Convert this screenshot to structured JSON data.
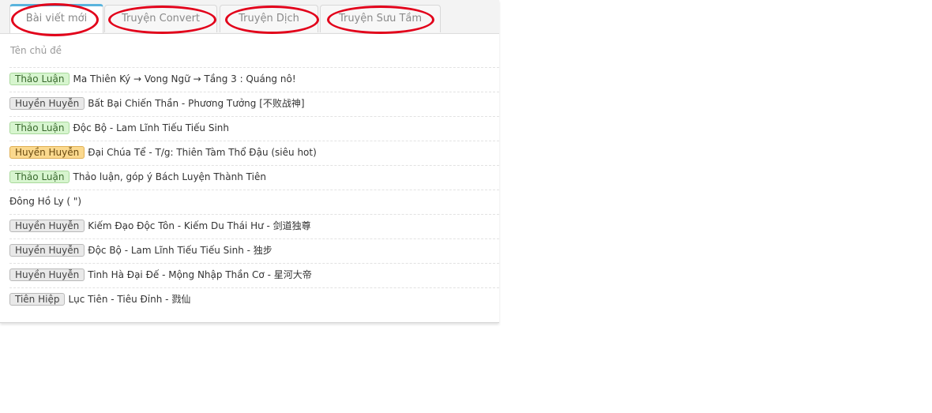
{
  "tabs": [
    {
      "label": "Bài viết mới"
    },
    {
      "label": "Truyện Convert"
    },
    {
      "label": "Truyện Dịch"
    },
    {
      "label": "Truyện Sưu Tầm"
    }
  ],
  "header": {
    "label": "Tên chủ đề"
  },
  "rows": [
    {
      "badge": "Thảo Luận",
      "badge_color": "#d7f5cf",
      "title": "Ma Thiên Ký → Vong Ngữ → Tầng 3 : Quáng nô!"
    },
    {
      "badge": "Huyền Huyễn",
      "badge_color": "#e9e9e9",
      "title": "Bất Bại Chiến Thần - Phương Tưởng [不败战神]"
    },
    {
      "badge": "Thảo Luận",
      "badge_color": "#d7f5cf",
      "title": "Độc Bộ - Lam Lĩnh Tiếu Tiếu Sinh"
    },
    {
      "badge": "Huyền Huyễn",
      "badge_color": "#fbd98e",
      "title": "Đại Chúa Tể - T/g: Thiên Tàm Thổ Đậu (siêu hot)"
    },
    {
      "badge": "Thảo Luận",
      "badge_color": "#d7f5cf",
      "title": "Thảo luận, góp ý Bách Luyện Thành Tiên"
    },
    {
      "badge": "",
      "badge_color": "",
      "title": "Đông Hồ Ly (      \")"
    },
    {
      "badge": "Huyền Huyễn",
      "badge_color": "#e9e9e9",
      "title": "Kiếm Đạo Độc Tôn - Kiếm Du Thái Hư - 剑道独尊"
    },
    {
      "badge": "Huyền Huyễn",
      "badge_color": "#e9e9e9",
      "title": "Độc Bộ - Lam Lĩnh Tiếu Tiếu Sinh - 独步"
    },
    {
      "badge": "Huyền Huyễn",
      "badge_color": "#e9e9e9",
      "title": "Tinh Hà Đại Đế - Mộng Nhập Thần Cơ - 星河大帝"
    },
    {
      "badge": "Tiên Hiệp",
      "badge_color": "#e9e9e9",
      "title": "Lục Tiên - Tiêu Đỉnh - 戮仙"
    }
  ],
  "colors": {
    "active_tab_accent": "#5ab4dd",
    "annotation_oval": "#e2001a"
  }
}
